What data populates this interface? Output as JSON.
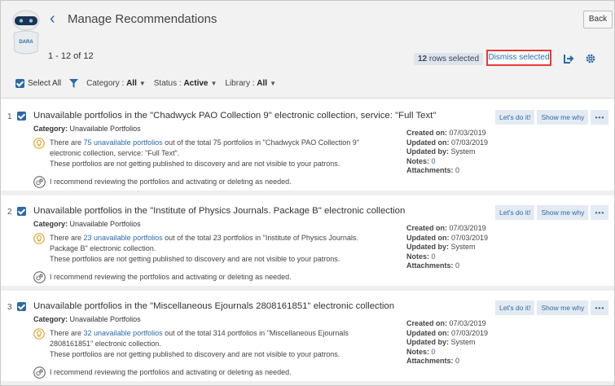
{
  "header": {
    "title": "Manage Recommendations",
    "back_label": "Back",
    "logo_text": "DARA",
    "range": "1 - 12 of 12",
    "rows_selected_count": "12",
    "rows_selected_suffix": " rows selected",
    "dismiss_label": "Dismiss selected"
  },
  "filters": {
    "select_all": "Select All",
    "category_label": "Category :",
    "category_value": "All",
    "status_label": "Status :",
    "status_value": "Active",
    "library_label": "Library :",
    "library_value": "All"
  },
  "actions": {
    "lets_do_it": "Let's do it!",
    "show_me_why": "Show me why",
    "more": "•••"
  },
  "meta_labels": {
    "created": "Created on:",
    "updated": "Updated on:",
    "updated_by": "Updated by:",
    "notes": "Notes:",
    "attachments": "Attachments:"
  },
  "cards": [
    {
      "num": "1",
      "title": "Unavailable portfolios in the \"Chadwyck PAO Collection 9\" electronic collection, service: \"Full Text\"",
      "category_label": "Category:",
      "category": "Unavailable Portfolios",
      "desc_pre": "There are ",
      "desc_link": "75 unavailable portfolios",
      "desc_post1": " out of the total 75 portfolios in \"Chadwyck PAO Collection 9\"",
      "desc_post2": "electronic collection, service: \"Full Text\".",
      "desc_line3": "These portfolios are not getting published to discovery and are not visible to your patrons.",
      "recommend": "I recommend reviewing the portfolios and activating or deleting as needed.",
      "created": "07/03/2019",
      "updated": "07/03/2019",
      "updated_by": "System",
      "notes": "0",
      "attachments": "0"
    },
    {
      "num": "2",
      "title": "Unavailable portfolios in the \"Institute of Physics Journals. Package B\" electronic collection",
      "category_label": "Category:",
      "category": "Unavailable Portfolios",
      "desc_pre": "There are ",
      "desc_link": "23 unavailable portfolios",
      "desc_post1": " out of the total 23 portfolios in \"Institute of Physics Journals.",
      "desc_post2": "Package B\" electronic collection.",
      "desc_line3": "These portfolios are not getting published to discovery and are not visible to your patrons.",
      "recommend": "I recommend reviewing the portfolios and activating or deleting as needed.",
      "created": "07/03/2019",
      "updated": "07/03/2019",
      "updated_by": "System",
      "notes": "0",
      "attachments": "0"
    },
    {
      "num": "3",
      "title": "Unavailable portfolios in the \"Miscellaneous Ejournals 2808161851\" electronic collection",
      "category_label": "Category:",
      "category": "Unavailable Portfolios",
      "desc_pre": "There are ",
      "desc_link": "32 unavailable portfolios",
      "desc_post1": " out of the total 314 portfolios in \"Miscellaneous Ejournals",
      "desc_post2": "2808161851\" electronic collection.",
      "desc_line3": "These portfolios are not getting published to discovery and are not visible to your patrons.",
      "recommend": "I recommend reviewing the portfolios and activating or deleting as needed.",
      "created": "07/03/2019",
      "updated": "07/03/2019",
      "updated_by": "System",
      "notes": "0",
      "attachments": "0"
    }
  ]
}
